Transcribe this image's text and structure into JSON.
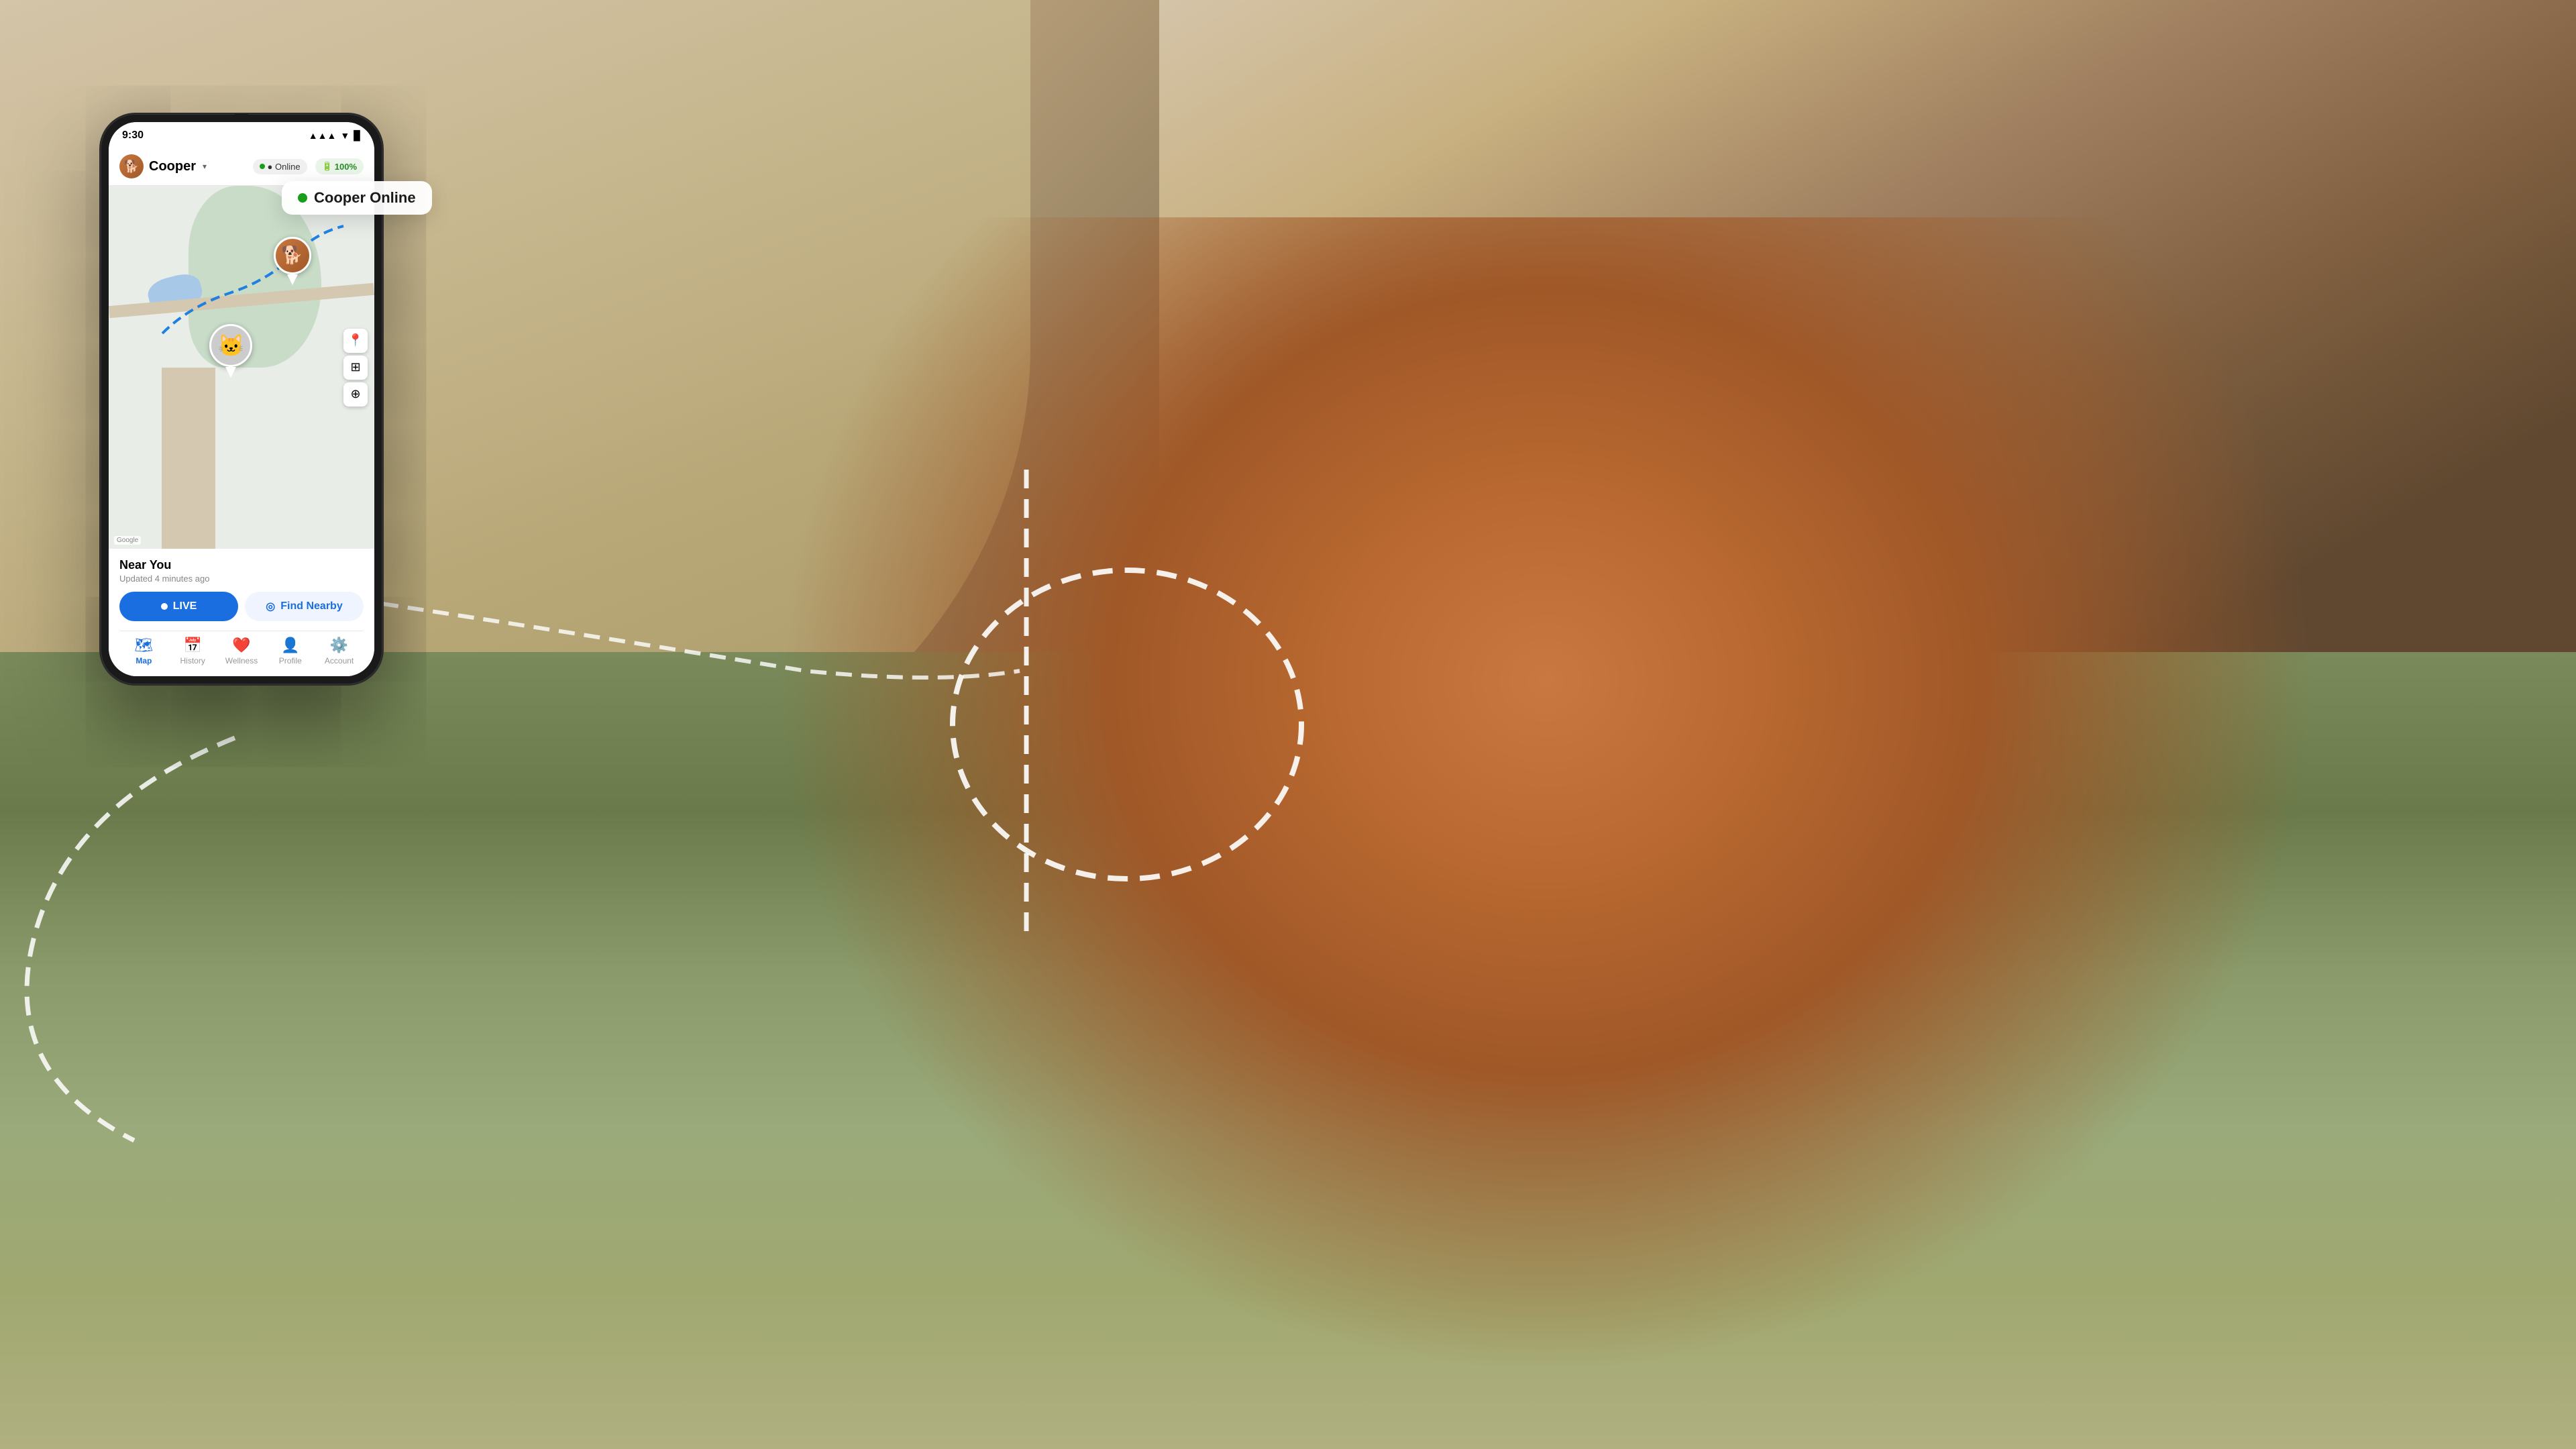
{
  "background": {
    "description": "Dog with harness standing on grassy cliff with sandy beach"
  },
  "phone": {
    "status_bar": {
      "time": "9:30",
      "battery_percent": "100%"
    },
    "header": {
      "pet_name": "Cooper",
      "pet_emoji": "🐕",
      "online_label": "● Online",
      "battery_label": "100%"
    },
    "map": {
      "google_label": "Google"
    },
    "bottom_panel": {
      "near_you_title": "Near You",
      "updated_text": "Updated 4 minutes ago",
      "live_button": "LIVE",
      "find_nearby_button": "Find Nearby"
    },
    "nav": {
      "map_label": "Map",
      "history_label": "History",
      "wellness_label": "Wellness",
      "profile_label": "Profile",
      "account_label": "Account"
    }
  },
  "cooper_online": {
    "text": "Cooper Online"
  },
  "icons": {
    "map": "🗺",
    "history": "📅",
    "wellness": "❤",
    "profile": "👤",
    "account": "👤",
    "location": "📍",
    "layers": "⊞",
    "cursor": "⊕",
    "signal": "▲▲▲",
    "wifi": "((·))",
    "cat_emoji": "🐱",
    "dog_emoji": "🐕",
    "live_icon": "⬤",
    "find_icon": "◎"
  },
  "colors": {
    "primary_blue": "#1a6ee0",
    "online_green": "#1a9e1a",
    "map_green": "#c8dcc8",
    "map_water": "#a8c8e8",
    "route_blue": "#2080e0"
  }
}
